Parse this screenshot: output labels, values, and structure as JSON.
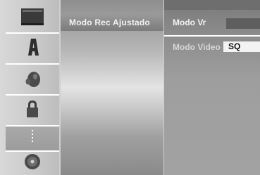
{
  "sidebar": {
    "items": [
      {
        "icon": "disc-tray-icon",
        "selected": false
      },
      {
        "icon": "letter-a-icon",
        "selected": false
      },
      {
        "icon": "speaker-audio-icon",
        "selected": false
      },
      {
        "icon": "padlock-icon",
        "selected": false
      },
      {
        "icon": "record-settings-icon",
        "selected": true
      },
      {
        "icon": "disc-icon",
        "selected": false
      }
    ]
  },
  "menu": {
    "section_label": "Modo Rec Ajustado"
  },
  "options": {
    "modo_vr_label": "Modo Vr",
    "modo_video_label": "Modo Video",
    "modo_video_value": "SQ"
  },
  "colors": {
    "highlight": "#5e5e5e",
    "value_box": "#f3f3f3",
    "rail_selected": "#a3a3a3"
  }
}
